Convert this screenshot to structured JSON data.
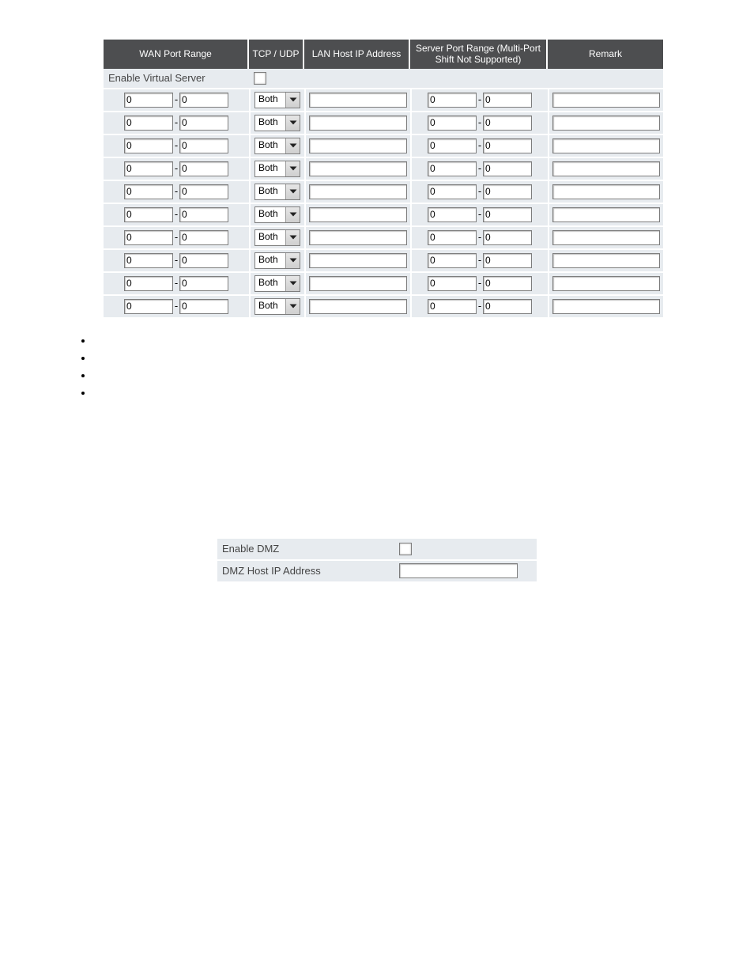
{
  "vs": {
    "enable_label": "Enable Virtual Server",
    "headers": {
      "wan": "WAN Port Range",
      "proto": "TCP / UDP",
      "lan": "LAN Host IP Address",
      "server": "Server Port Range (Multi-Port Shift Not Supported)",
      "remark": "Remark"
    },
    "rows": [
      {
        "wan_from": "0",
        "wan_to": "0",
        "proto": "Both",
        "lan": "",
        "srv_from": "0",
        "srv_to": "0",
        "remark": ""
      },
      {
        "wan_from": "0",
        "wan_to": "0",
        "proto": "Both",
        "lan": "",
        "srv_from": "0",
        "srv_to": "0",
        "remark": ""
      },
      {
        "wan_from": "0",
        "wan_to": "0",
        "proto": "Both",
        "lan": "",
        "srv_from": "0",
        "srv_to": "0",
        "remark": ""
      },
      {
        "wan_from": "0",
        "wan_to": "0",
        "proto": "Both",
        "lan": "",
        "srv_from": "0",
        "srv_to": "0",
        "remark": ""
      },
      {
        "wan_from": "0",
        "wan_to": "0",
        "proto": "Both",
        "lan": "",
        "srv_from": "0",
        "srv_to": "0",
        "remark": ""
      },
      {
        "wan_from": "0",
        "wan_to": "0",
        "proto": "Both",
        "lan": "",
        "srv_from": "0",
        "srv_to": "0",
        "remark": ""
      },
      {
        "wan_from": "0",
        "wan_to": "0",
        "proto": "Both",
        "lan": "",
        "srv_from": "0",
        "srv_to": "0",
        "remark": ""
      },
      {
        "wan_from": "0",
        "wan_to": "0",
        "proto": "Both",
        "lan": "",
        "srv_from": "0",
        "srv_to": "0",
        "remark": ""
      },
      {
        "wan_from": "0",
        "wan_to": "0",
        "proto": "Both",
        "lan": "",
        "srv_from": "0",
        "srv_to": "0",
        "remark": ""
      },
      {
        "wan_from": "0",
        "wan_to": "0",
        "proto": "Both",
        "lan": "",
        "srv_from": "0",
        "srv_to": "0",
        "remark": ""
      }
    ]
  },
  "dash": "-",
  "dmz": {
    "enable_label": "Enable DMZ",
    "ip_label": "DMZ Host IP Address",
    "ip_value": ""
  }
}
